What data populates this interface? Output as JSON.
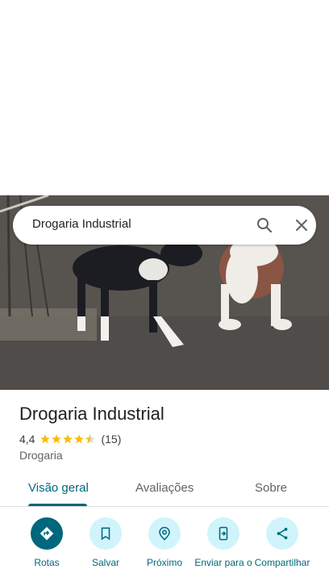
{
  "search": {
    "query": "Drogaria Industrial"
  },
  "place": {
    "name": "Drogaria Industrial",
    "rating": "4,4",
    "rating_stars": 4.4,
    "review_count": "(15)",
    "category": "Drogaria"
  },
  "tabs": [
    {
      "label": "Visão geral",
      "active": true
    },
    {
      "label": "Avaliações",
      "active": false
    },
    {
      "label": "Sobre",
      "active": false
    }
  ],
  "actions": [
    {
      "label": "Rotas",
      "icon": "directions-icon"
    },
    {
      "label": "Salvar",
      "icon": "bookmark-icon"
    },
    {
      "label": "Próximo",
      "icon": "nearby-icon"
    },
    {
      "label": "Enviar para o",
      "icon": "send-to-phone-icon"
    },
    {
      "label": "Compartilhar",
      "icon": "share-icon"
    }
  ],
  "colors": {
    "accent": "#00677d",
    "accent_light": "#d0f4fb",
    "star": "#fbbc04"
  }
}
